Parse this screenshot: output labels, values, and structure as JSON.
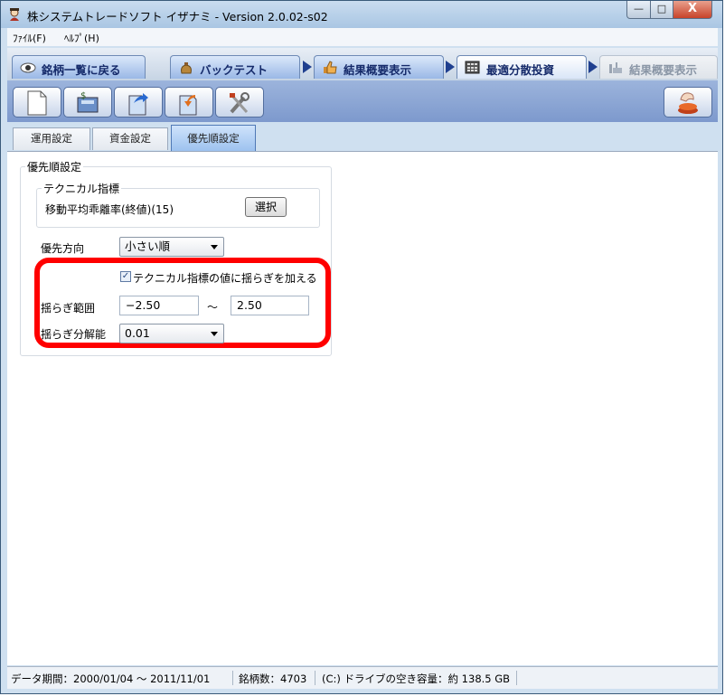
{
  "window": {
    "title": "株システムトレードソフト イザナミ - Version 2.0.02-s02",
    "buttons": {
      "minimize": "—",
      "maximize": "□",
      "close": "X"
    }
  },
  "menu": {
    "file": "ﾌｧｲﾙ(F)",
    "help": "ﾍﾙﾌﾟ(H)"
  },
  "nav_tabs": [
    {
      "label": "銘柄一覧に戻る",
      "icon": "eye-icon",
      "state": "normal"
    },
    {
      "label": "バックテスト",
      "icon": "money-bag-icon",
      "state": "normal"
    },
    {
      "label": "結果概要表示",
      "icon": "thumbs-up-icon",
      "state": "normal"
    },
    {
      "label": "最適分散投資",
      "icon": "calculator-icon",
      "state": "active"
    },
    {
      "label": "結果概要表示",
      "icon": "factory-icon",
      "state": "disabled"
    }
  ],
  "toolbar": {
    "buttons": [
      "new-document-icon",
      "money-calc-icon",
      "export-icon",
      "import-icon",
      "tools-icon"
    ],
    "right_button": "hand-icon"
  },
  "settings_tabs": [
    "運用設定",
    "資金設定",
    "優先順設定"
  ],
  "priority": {
    "group_caption": "優先順設定",
    "technical": {
      "caption": "テクニカル指標",
      "indicator": "移動平均乖離率(終値)(15)",
      "select_button": "選択"
    },
    "direction": {
      "label": "優先方向",
      "value": "小さい順"
    },
    "jitter": {
      "checkbox_label": "テクニカル指標の値に揺らぎを加える",
      "checked": true,
      "range_label": "揺らぎ範囲",
      "range_min": "−2.50",
      "range_sep": "～",
      "range_max": "2.50",
      "resolution_label": "揺らぎ分解能",
      "resolution_value": "0.01"
    }
  },
  "status": {
    "period": "データ期間：2000/01/04 ～ 2011/11/01",
    "count": "銘柄数：4703",
    "disk": "(C:) ドライブの空き容量：約 138.5 GB"
  },
  "colors": {
    "highlight": "#ff0000",
    "accent": "#1f3f8f"
  }
}
